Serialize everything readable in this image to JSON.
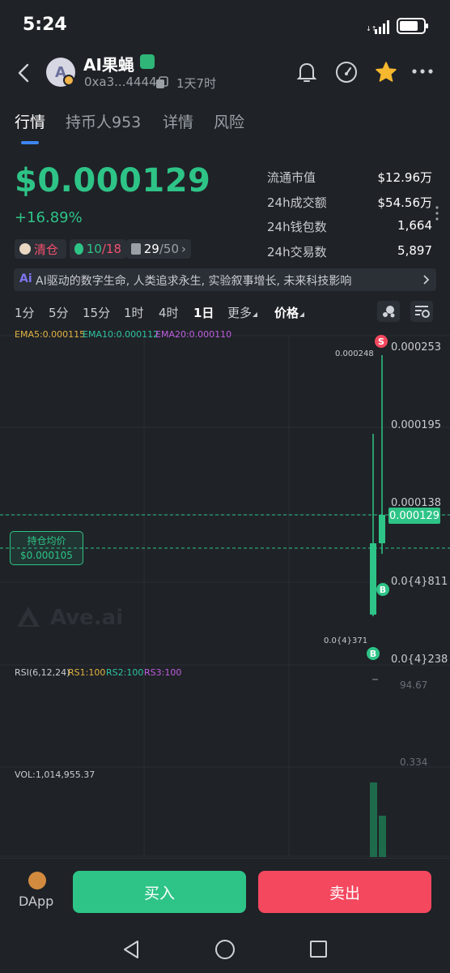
{
  "status_bar": {
    "time": "5:24",
    "battery_level": 0.8
  },
  "header": {
    "avatar_letter": "A",
    "token_name": "AI果蝇",
    "contract": "0xa3...4444",
    "age": "1天7时"
  },
  "tabs": [
    {
      "label": "行情",
      "active": true
    },
    {
      "label": "持币人953",
      "active": false
    },
    {
      "label": "详情",
      "active": false
    },
    {
      "label": "风险",
      "active": false
    }
  ],
  "price": {
    "value": "$0.000129",
    "change": "+16.89%"
  },
  "stats": [
    {
      "label": "流通市值",
      "value": "$12.96万"
    },
    {
      "label": "24h成交额",
      "value": "$54.56万"
    },
    {
      "label": "24h钱包数",
      "value": "1,664"
    },
    {
      "label": "24h交易数",
      "value": "5,897"
    }
  ],
  "chips": {
    "clear": "清仓",
    "money_green": "10",
    "money_red": "/18",
    "crown_value": "29",
    "crown_total": "/50"
  },
  "description": {
    "ai_badge": "Ai",
    "text": "AI驱动的数字生命, 人类追求永生, 实验叙事增长, 未来科技影响"
  },
  "timeframes": [
    "1分",
    "5分",
    "15分",
    "1时",
    "4时",
    "1日"
  ],
  "timeframe_active": "1日",
  "more_label": "更多",
  "price_label": "价格",
  "chart": {
    "ema5": "EMA5:0.000115",
    "ema10": "EMA10:0.000112",
    "ema20": "EMA20:0.000110",
    "axis": [
      "0.000253",
      "0.000195",
      "0.000138",
      "0.0{4}811",
      "0.0{4}238"
    ],
    "current_price": "0.000129",
    "avg_title": "持仓均价",
    "avg_value": "$0.000105",
    "high_label": "0.000248",
    "low_label": "0.0{4}371",
    "marker_sell": "S",
    "marker_buy": "B",
    "watermark": "Ave.ai",
    "rsi_title": "RSI(6,12,24)",
    "rsi1": "RS1:100",
    "rsi2": "RS2:100",
    "rsi3": "RS3:100",
    "rsi_top": "94.67",
    "rsi_bottom": "0.334",
    "vol": "VOL:1,014,955.37",
    "colors": {
      "up": "#2ec487",
      "down": "#f4485f",
      "ema5": "#e3b341",
      "ema10": "#2ec4a0",
      "ema20": "#c05ee0"
    }
  },
  "bottom": {
    "dapp": "DApp",
    "buy": "买入",
    "sell": "卖出"
  }
}
